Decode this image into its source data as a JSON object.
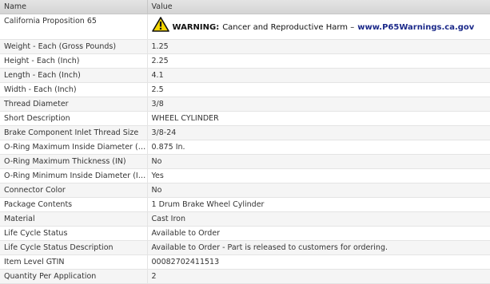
{
  "table": {
    "header": {
      "name": "Name",
      "value": "Value"
    },
    "prop65": {
      "name": "California Proposition 65",
      "warning_label": "WARNING:",
      "warning_text": "Cancer and Reproductive Harm –",
      "warning_link": "www.P65Warnings.ca.gov",
      "icon": "warning-triangle-icon",
      "icon_fill": "#f5d600"
    },
    "rows": [
      {
        "name": "Weight - Each (Gross Pounds)",
        "value": "1.25"
      },
      {
        "name": "Height - Each (Inch)",
        "value": "2.25"
      },
      {
        "name": "Length - Each (Inch)",
        "value": "4.1"
      },
      {
        "name": "Width - Each (Inch)",
        "value": "2.5"
      },
      {
        "name": "Thread Diameter",
        "value": "3/8"
      },
      {
        "name": "Short Description",
        "value": "WHEEL CYLINDER"
      },
      {
        "name": "Brake Component Inlet Thread Size",
        "value": "3/8-24"
      },
      {
        "name": "O-Ring Maximum Inside Diameter (M...",
        "value": "0.875 In."
      },
      {
        "name": "O-Ring Maximum Thickness (IN)",
        "value": "No"
      },
      {
        "name": "O-Ring Minimum Inside Diameter (IN)",
        "value": "Yes"
      },
      {
        "name": "Connector Color",
        "value": "No"
      },
      {
        "name": "Package Contents",
        "value": "1 Drum Brake Wheel Cylinder"
      },
      {
        "name": "Material",
        "value": "Cast Iron"
      },
      {
        "name": "Life Cycle Status",
        "value": "Available to Order"
      },
      {
        "name": "Life Cycle Status Description",
        "value": "Available to Order - Part is released to customers for ordering."
      },
      {
        "name": "Item Level GTIN",
        "value": "00082702411513"
      },
      {
        "name": "Quantity Per Application",
        "value": "2"
      }
    ]
  }
}
